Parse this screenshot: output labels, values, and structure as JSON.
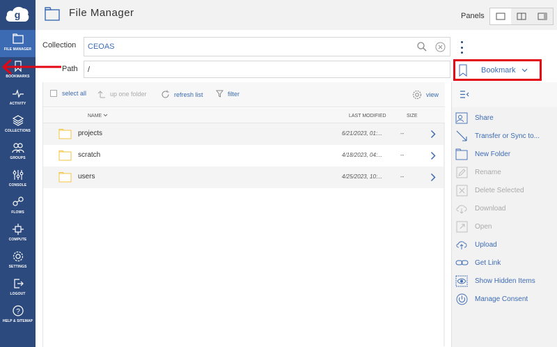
{
  "sidebar": {
    "logo_icon": "globus-cloud-logo",
    "items": [
      {
        "label": "FILE MANAGER",
        "icon": "file-manager-icon",
        "active": true
      },
      {
        "label": "BOOKMARKS",
        "icon": "bookmark-icon"
      },
      {
        "label": "ACTIVITY",
        "icon": "activity-icon"
      },
      {
        "label": "COLLECTIONS",
        "icon": "collections-icon"
      },
      {
        "label": "GROUPS",
        "icon": "groups-icon"
      },
      {
        "label": "CONSOLE",
        "icon": "console-icon"
      },
      {
        "label": "FLOWS",
        "icon": "flows-icon"
      },
      {
        "label": "COMPUTE",
        "icon": "compute-icon"
      },
      {
        "label": "SETTINGS",
        "icon": "settings-icon"
      },
      {
        "label": "LOGOUT",
        "icon": "logout-icon"
      },
      {
        "label": "HELP & SITEMAP",
        "icon": "help-icon"
      }
    ]
  },
  "header": {
    "title": "File Manager",
    "panels_label": "Panels"
  },
  "collection": {
    "label": "Collection",
    "value": "CEOAS"
  },
  "path": {
    "label": "Path",
    "value": "/"
  },
  "bookmark": {
    "label": "Bookmark"
  },
  "toolbar": {
    "select_all": "select all",
    "up_one_folder": "up one folder",
    "refresh_list": "refresh list",
    "filter": "filter",
    "view": "view"
  },
  "columns": {
    "name": "NAME",
    "last_modified": "LAST MODIFIED",
    "size": "SIZE"
  },
  "files": [
    {
      "name": "projects",
      "modified": "6/21/2023, 01:...",
      "size": "--"
    },
    {
      "name": "scratch",
      "modified": "4/18/2023, 04:...",
      "size": "--"
    },
    {
      "name": "users",
      "modified": "4/25/2023, 10:...",
      "size": "--"
    }
  ],
  "actions": [
    {
      "label": "Share",
      "icon": "share-icon",
      "enabled": true
    },
    {
      "label": "Transfer or Sync to...",
      "icon": "transfer-icon",
      "enabled": true
    },
    {
      "label": "New Folder",
      "icon": "new-folder-icon",
      "enabled": true
    },
    {
      "label": "Rename",
      "icon": "rename-icon",
      "enabled": false
    },
    {
      "label": "Delete Selected",
      "icon": "delete-icon",
      "enabled": false
    },
    {
      "label": "Download",
      "icon": "download-icon",
      "enabled": false
    },
    {
      "label": "Open",
      "icon": "open-icon",
      "enabled": false
    },
    {
      "label": "Upload",
      "icon": "upload-icon",
      "enabled": true
    },
    {
      "label": "Get Link",
      "icon": "link-icon",
      "enabled": true
    },
    {
      "label": "Show Hidden Items",
      "icon": "eye-icon",
      "enabled": true
    },
    {
      "label": "Manage Consent",
      "icon": "power-icon",
      "enabled": true
    }
  ],
  "colors": {
    "sidebar_bg": "#2c4a7d",
    "sidebar_active": "#3d6bb3",
    "accent": "#3d6bb3",
    "highlight_red": "#e30613",
    "folder_yellow": "#f5c342"
  }
}
